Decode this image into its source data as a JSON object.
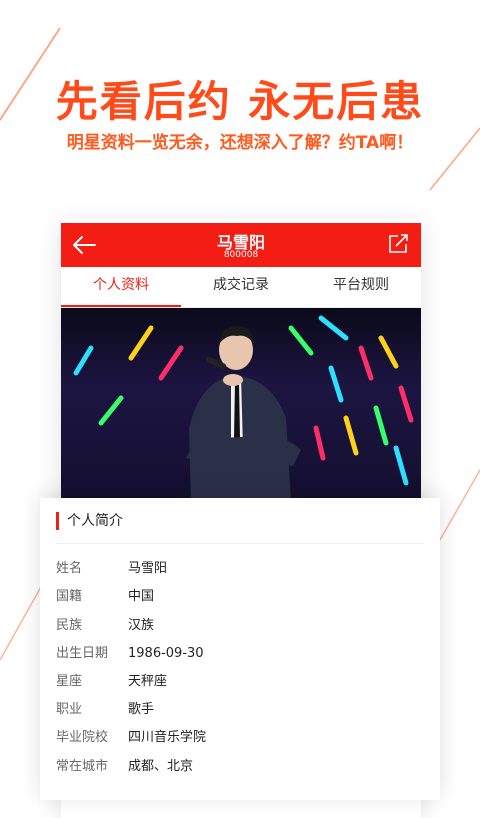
{
  "promo": {
    "headline": "先看后约 永无后患",
    "subline": "明星资料一览无余，还想深入了解？约TA啊！"
  },
  "header": {
    "title": "马雪阳",
    "subtitle": "800008",
    "back_icon": "arrow-left-icon",
    "share_icon": "share-icon"
  },
  "tabs": [
    {
      "label": "个人资料",
      "active": true
    },
    {
      "label": "成交记录",
      "active": false
    },
    {
      "label": "平台规则",
      "active": false
    }
  ],
  "profile": {
    "section_title": "个人简介",
    "rows": [
      {
        "label": "姓名",
        "value": "马雪阳"
      },
      {
        "label": "国籍",
        "value": "中国"
      },
      {
        "label": "民族",
        "value": "汉族"
      },
      {
        "label": "出生日期",
        "value": "1986-09-30"
      },
      {
        "label": "星座",
        "value": "天秤座"
      },
      {
        "label": "职业",
        "value": "歌手"
      },
      {
        "label": "毕业院校",
        "value": "四川音乐学院"
      },
      {
        "label": "常在城市",
        "value": "成都、北京"
      }
    ]
  },
  "colors": {
    "accent": "#f31d13",
    "promo": "#ff4a1a"
  }
}
